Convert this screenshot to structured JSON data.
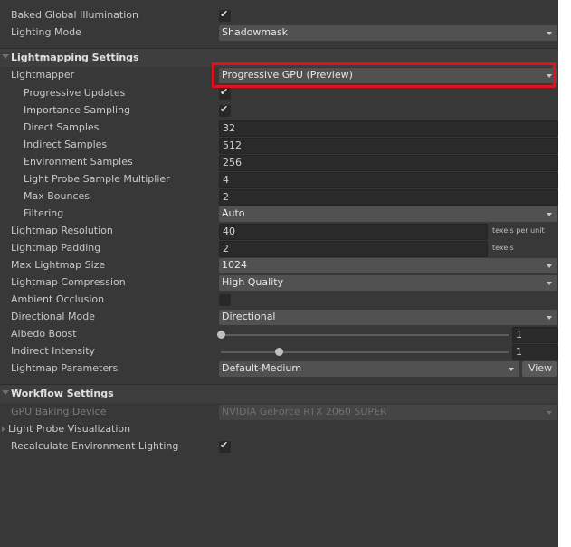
{
  "top": {
    "baked_gi": {
      "label": "Baked Global Illumination",
      "checked": true
    },
    "lighting_mode": {
      "label": "Lighting Mode",
      "value": "Shadowmask"
    }
  },
  "lightmapping": {
    "title": "Lightmapping Settings",
    "lightmapper": {
      "label": "Lightmapper",
      "value": "Progressive GPU (Preview)"
    },
    "progressive_updates": {
      "label": "Progressive Updates",
      "checked": true
    },
    "importance_sampling": {
      "label": "Importance Sampling",
      "checked": true
    },
    "direct_samples": {
      "label": "Direct Samples",
      "value": "32"
    },
    "indirect_samples": {
      "label": "Indirect Samples",
      "value": "512"
    },
    "environment_samples": {
      "label": "Environment Samples",
      "value": "256"
    },
    "light_probe_multiplier": {
      "label": "Light Probe Sample Multiplier",
      "value": "4"
    },
    "max_bounces": {
      "label": "Max Bounces",
      "value": "2"
    },
    "filtering": {
      "label": "Filtering",
      "value": "Auto"
    },
    "lightmap_resolution": {
      "label": "Lightmap Resolution",
      "value": "40",
      "unit": "texels per unit"
    },
    "lightmap_padding": {
      "label": "Lightmap Padding",
      "value": "2",
      "unit": "texels"
    },
    "max_lightmap_size": {
      "label": "Max Lightmap Size",
      "value": "1024"
    },
    "lightmap_compression": {
      "label": "Lightmap Compression",
      "value": "High Quality"
    },
    "ambient_occlusion": {
      "label": "Ambient Occlusion",
      "checked": false
    },
    "directional_mode": {
      "label": "Directional Mode",
      "value": "Directional"
    },
    "albedo_boost": {
      "label": "Albedo Boost",
      "value": "1",
      "slider_fraction": 0.0
    },
    "indirect_intensity": {
      "label": "Indirect Intensity",
      "value": "1",
      "slider_fraction": 0.2
    },
    "lightmap_parameters": {
      "label": "Lightmap Parameters",
      "value": "Default-Medium",
      "button": "View"
    }
  },
  "workflow": {
    "title": "Workflow Settings",
    "gpu_device": {
      "label": "GPU Baking Device",
      "value": "NVIDIA GeForce RTX 2060 SUPER"
    },
    "light_probe_viz": {
      "label": "Light Probe Visualization"
    },
    "recalc_env": {
      "label": "Recalculate Environment Lighting",
      "checked": true
    }
  },
  "colors": {
    "highlight": "#e0121b",
    "background": "#383838"
  }
}
